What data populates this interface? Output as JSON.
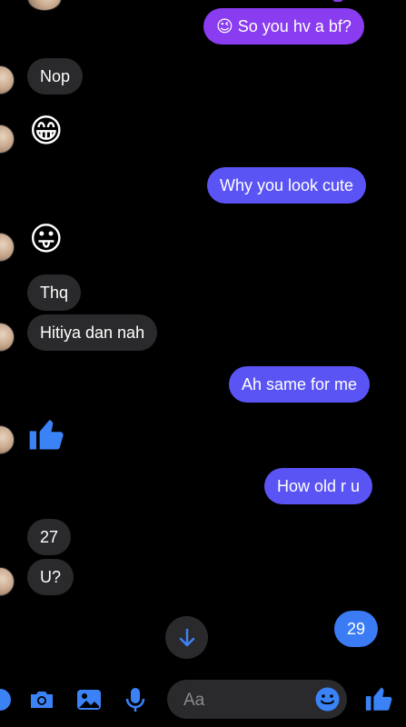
{
  "messages": {
    "top_outgoing": {
      "emoji": "😉",
      "text": "So you hv a bf?"
    },
    "nop": "Nop",
    "grin_emoji": "😁",
    "why_cute": "Why you look cute",
    "tongue_emoji": "😛",
    "thq": "Thq",
    "hitiya": "Hitiya dan nah",
    "ah_same": "Ah same for me",
    "how_old": "How old r u",
    "age_27": "27",
    "u": "U?",
    "age_29": "29"
  },
  "composer": {
    "placeholder": "Aa"
  },
  "icons": {
    "like": "thumbs-up-icon",
    "camera": "camera-icon",
    "gallery": "image-icon",
    "mic": "microphone-icon",
    "emoji": "smiley-icon",
    "scroll": "arrow-down-icon"
  },
  "colors": {
    "outgoing": "#5b54f5",
    "outgoing_top": "#8a3cf0",
    "incoming": "#2a2a2c",
    "accent": "#3b82f6"
  }
}
